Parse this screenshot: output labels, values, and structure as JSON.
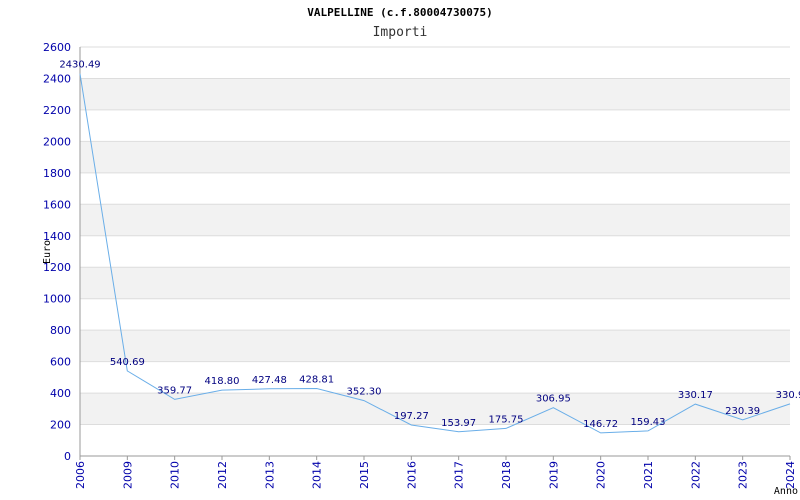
{
  "chart_data": {
    "type": "line",
    "title": "VALPELLINE (c.f.80004730075)",
    "subtitle": "Importi",
    "xlabel": "Anno",
    "ylabel": "Euro",
    "ylim": [
      0,
      2600
    ],
    "yticks": [
      0,
      200,
      400,
      600,
      800,
      1000,
      1200,
      1400,
      1600,
      1800,
      2000,
      2200,
      2400,
      2600
    ],
    "grid": "horizontal bands",
    "categories": [
      "2006",
      "2009",
      "2010",
      "2012",
      "2013",
      "2014",
      "2015",
      "2016",
      "2017",
      "2018",
      "2019",
      "2020",
      "2021",
      "2022",
      "2023",
      "2024"
    ],
    "series": [
      {
        "values": [
          2430.49,
          540.69,
          359.77,
          418.8,
          427.48,
          428.81,
          352.3,
          197.27,
          153.97,
          175.75,
          306.95,
          146.72,
          159.43,
          330.17,
          230.39,
          330.9
        ],
        "labels": [
          "2430.49",
          "540.69",
          "359.77",
          "418.80",
          "427.48",
          "428.81",
          "352.30",
          "197.27",
          "153.97",
          "175.75",
          "306.95",
          "146.72",
          "159.43",
          "330.17",
          "230.39",
          "330.9"
        ]
      }
    ],
    "colors": {
      "line": "#6aaee8",
      "band": "#f2f2f2",
      "gridline": "#dddddd",
      "tick_text": "#0000aa",
      "label_text": "#000080"
    }
  }
}
